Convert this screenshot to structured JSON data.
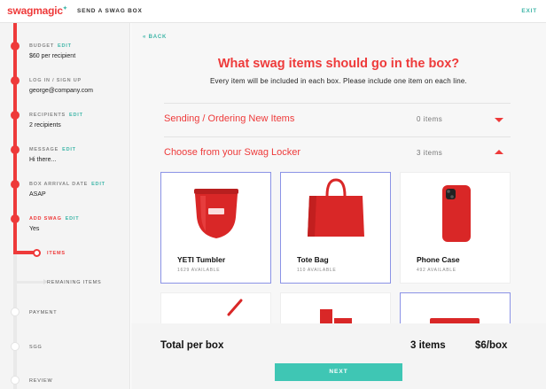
{
  "app": {
    "logo_text": "swagmagic",
    "title": "SEND A SWAG BOX",
    "exit_label": "EXIT"
  },
  "colors": {
    "accent_red": "#ee3a3a",
    "accent_teal": "#3fb6a8",
    "selected_border": "#8b93e6"
  },
  "sidebar": {
    "edit_label": "EDIT",
    "steps": [
      {
        "label": "BUDGET",
        "value": "$60 per recipient",
        "editable": true,
        "state": "done"
      },
      {
        "label": "LOG IN / SIGN UP",
        "value": "george@company.com",
        "editable": false,
        "state": "done"
      },
      {
        "label": "RECIPIENTS",
        "value": "2 recipients",
        "editable": true,
        "state": "done"
      },
      {
        "label": "MESSAGE",
        "value": "Hi there...",
        "editable": true,
        "state": "done"
      },
      {
        "label": "BOX ARRIVAL DATE",
        "value": "ASAP",
        "editable": true,
        "state": "done"
      },
      {
        "label": "ADD SWAG",
        "value": "Yes",
        "editable": true,
        "state": "active"
      },
      {
        "label": "ITEMS",
        "value": "",
        "editable": false,
        "state": "current-sub"
      },
      {
        "label": "REMAINING ITEMS",
        "value": "",
        "editable": false,
        "state": "pending-sub"
      },
      {
        "label": "PAYMENT",
        "value": "",
        "editable": false,
        "state": "pending"
      },
      {
        "label": "SGG",
        "value": "",
        "editable": false,
        "state": "pending"
      },
      {
        "label": "REVIEW",
        "value": "",
        "editable": false,
        "state": "pending"
      }
    ]
  },
  "main": {
    "back_label": "«  BACK",
    "heading": "What swag items should go in the box?",
    "subheading": "Every item will be included in each box. Please include one item on each line.",
    "sections": [
      {
        "title": "Sending / Ordering New Items",
        "count": "0 items",
        "expanded": false
      },
      {
        "title": "Choose from your Swag Locker",
        "count": "3 items",
        "expanded": true
      }
    ],
    "items": [
      {
        "name": "YETI Tumbler",
        "available": "1629 AVAILABLE",
        "selected": true,
        "icon": "tumbler-icon"
      },
      {
        "name": "Tote Bag",
        "available": "110 AVAILABLE",
        "selected": true,
        "icon": "tote-bag-icon"
      },
      {
        "name": "Phone Case",
        "available": "492 AVAILABLE",
        "selected": false,
        "icon": "phone-case-icon"
      },
      {
        "name": "",
        "available": "",
        "selected": false,
        "icon": "pen-icon"
      },
      {
        "name": "",
        "available": "",
        "selected": false,
        "icon": "notebook-icon"
      },
      {
        "name": "",
        "available": "",
        "selected": true,
        "icon": "pencil-case-icon"
      }
    ]
  },
  "footer": {
    "total_label": "Total per box",
    "total_items": "3 items",
    "total_price": "$6/box",
    "next_label": "NEXT"
  }
}
